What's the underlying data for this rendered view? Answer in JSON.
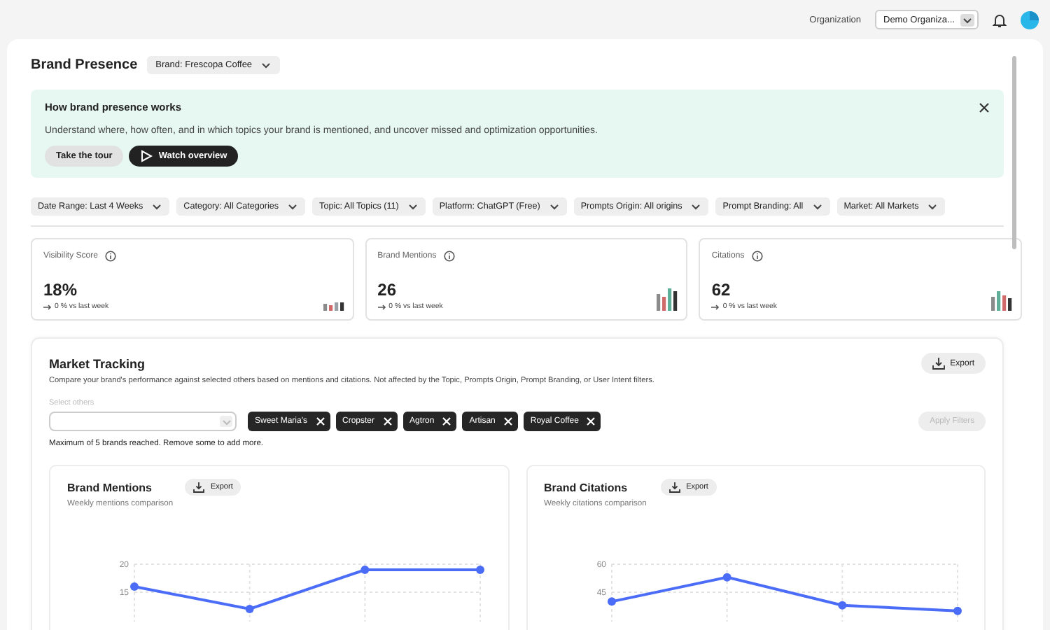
{
  "topbar": {
    "org_label": "Organization",
    "org_value": "Demo Organiza..."
  },
  "header": {
    "title": "Brand Presence",
    "brand_dropdown": "Brand: Frescopa Coffee"
  },
  "banner": {
    "title": "How brand presence works",
    "text": "Understand where, how often, and in which topics your brand is mentioned, and uncover missed and optimization opportunities.",
    "buttons": [
      {
        "label": "Take the tour",
        "kind": "secondary"
      },
      {
        "label": "Watch overview",
        "kind": "primary"
      }
    ]
  },
  "filters": [
    "Date Range: Last 4 Weeks",
    "Category: All Categories",
    "Topic: All Topics (11)",
    "Platform: ChatGPT (Free)",
    "Prompts Origin: All origins",
    "Prompt Branding: All",
    "Market: All Markets"
  ],
  "metrics": [
    {
      "label": "Visibility Score",
      "value": "18%",
      "change": "0 % vs last week"
    },
    {
      "label": "Brand Mentions",
      "value": "26",
      "change": "0 % vs last week"
    },
    {
      "label": "Citations",
      "value": "62",
      "change": "0 % vs last week"
    }
  ],
  "market_tracking": {
    "title": "Market Tracking",
    "export": "Export",
    "description": "Compare your brand's performance against selected others based on mentions and citations. Not affected by the Topic, Prompts Origin, Prompt Branding, or User Intent filters.",
    "select_label": "Select others",
    "tags": [
      "Sweet Maria's",
      "Cropster",
      "Agtron",
      "Artisan",
      "Royal Coffee"
    ],
    "limit_note": "Maximum of 5 brands reached. Remove some to add more.",
    "apply_button": {
      "label": "Apply Filters",
      "disabled": true
    },
    "charts": [
      {
        "title": "Brand Mentions",
        "export": "Export",
        "subtitle": "Weekly mentions comparison",
        "chart_data": {
          "type": "line",
          "ylim": [
            10,
            20
          ],
          "yticks": [
            15,
            20
          ],
          "grid": true,
          "series": [
            {
              "color": "#4a6cf7",
              "marker": "circle",
              "values": [
                16,
                12,
                19,
                19
              ]
            }
          ]
        }
      },
      {
        "title": "Brand Citations",
        "export": "Export",
        "subtitle": "Weekly citations comparison",
        "chart_data": {
          "type": "line",
          "ylim": [
            30,
            60
          ],
          "yticks": [
            45,
            60
          ],
          "grid": true,
          "series": [
            {
              "color": "#4a6cf7",
              "marker": "circle",
              "values": [
                40,
                53,
                38,
                35
              ]
            }
          ]
        }
      }
    ]
  }
}
